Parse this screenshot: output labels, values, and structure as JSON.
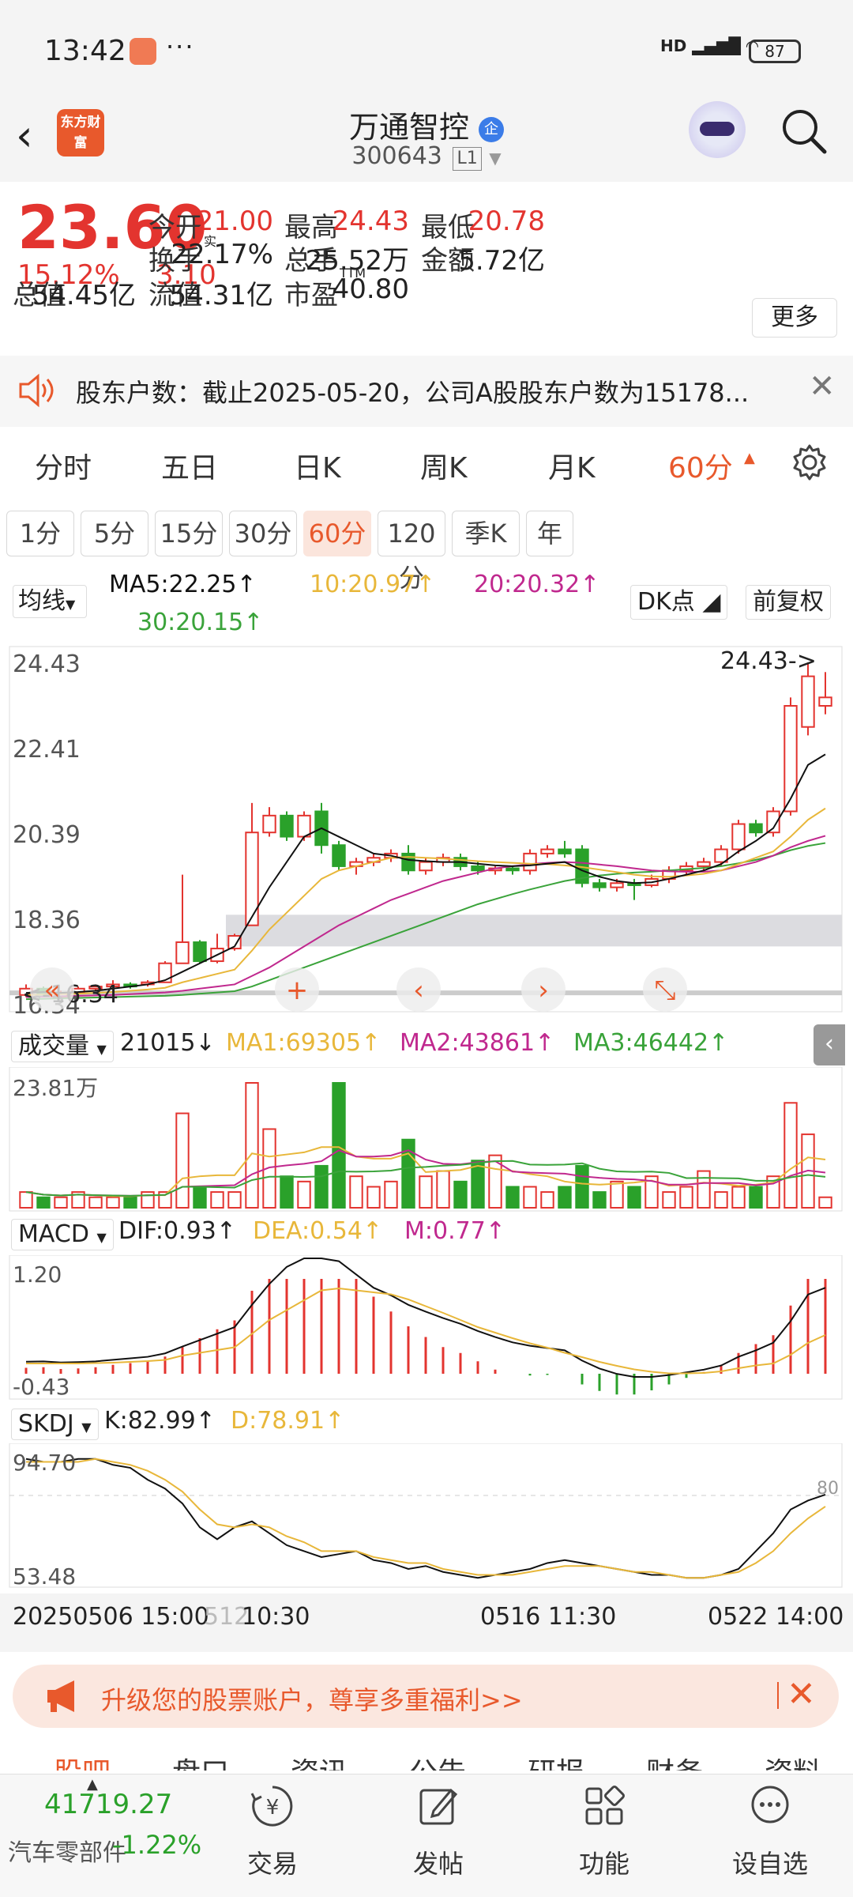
{
  "status_bar": {
    "time": "13:42",
    "battery": "87",
    "signal_label": "HD"
  },
  "header": {
    "logo_text": "东方财富",
    "stock_name": "万通智控",
    "stock_badge": "企",
    "stock_code": "300643",
    "market_tag": "L1"
  },
  "quote": {
    "price": "23.60",
    "change_pct": "15.12%",
    "change_amt": "3.10",
    "fields": [
      {
        "label": "今开",
        "value": "21.00",
        "color": "red"
      },
      {
        "label": "最高",
        "value": "24.43",
        "color": "red"
      },
      {
        "label": "最低",
        "value": "20.78",
        "color": "red"
      },
      {
        "label": "换手",
        "label_sup": "实",
        "value": "22.17%",
        "color": "black"
      },
      {
        "label": "总手",
        "value": "25.52万",
        "color": "black"
      },
      {
        "label": "金额",
        "value": "5.72亿",
        "color": "black"
      },
      {
        "label": "总值",
        "value": "54.45亿",
        "color": "black"
      },
      {
        "label": "流值",
        "value": "54.31亿",
        "color": "black"
      },
      {
        "label": "市盈",
        "label_sup": "TTM",
        "value": "40.80",
        "color": "black"
      }
    ],
    "more_label": "更多"
  },
  "notice": {
    "text": "股东户数：截止2025-05-20，公司A股股东户数为15178..."
  },
  "period_tabs": [
    "分时",
    "五日",
    "日K",
    "周K",
    "月K",
    "60分"
  ],
  "active_period": "60分",
  "sub_tabs": [
    "1分",
    "5分",
    "15分",
    "30分",
    "60分",
    "120分",
    "季K",
    "年"
  ],
  "active_sub_tab": "60分",
  "ma_legend": {
    "selector": "均线",
    "ma5": "MA5:22.25↑",
    "ma10": "10:20.97↑",
    "ma20": "20:20.32↑",
    "ma30": "30:20.15↑",
    "dk_label": "DK点",
    "adjust_label": "前复权"
  },
  "kline": {
    "y_labels": [
      "24.43",
      "22.41",
      "20.39",
      "18.36",
      "16.34"
    ],
    "high_marker": "24.43->",
    "low_marker": "<-16.34"
  },
  "volume": {
    "selector": "成交量",
    "current": "21015↓",
    "ma1": "MA1:69305↑",
    "ma2": "MA2:43861↑",
    "ma3": "MA3:46442↑",
    "y_label": "23.81万"
  },
  "macd": {
    "selector": "MACD",
    "dif": "DIF:0.93↑",
    "dea": "DEA:0.54↑",
    "m": "M:0.77↑",
    "y_labels": [
      "1.20",
      "-0.43"
    ]
  },
  "skdj": {
    "selector": "SKDJ",
    "k": "K:82.99↑",
    "d": "D:78.91↑",
    "y_labels": [
      "94.70",
      "53.48"
    ],
    "ref_label": "80"
  },
  "time_axis": [
    "20250506 15:00",
    "512 10:30",
    "0516 11:30",
    "0522 14:00"
  ],
  "ad": {
    "text": "升级您的股票账户，尊享多重福利>>"
  },
  "bottom_tabs": [
    "股吧",
    "盘口",
    "资讯",
    "公告",
    "研报",
    "财务",
    "资料"
  ],
  "bottom_bar": {
    "index_value": "41719.27",
    "index_name": "汽车零部件",
    "index_pct": "-1.22%",
    "buttons": [
      {
        "label": "交易",
        "icon": "yen-cycle-icon"
      },
      {
        "label": "发帖",
        "icon": "edit-icon"
      },
      {
        "label": "功能",
        "icon": "grid-icon"
      },
      {
        "label": "设自选",
        "icon": "chat-dots-icon"
      }
    ]
  },
  "colors": {
    "up": "#e3342f",
    "down": "#2aa12a",
    "ma5": "#111111",
    "ma10": "#e8b73a",
    "ma20": "#c0288e",
    "ma30": "#3aa33a",
    "accent": "#e8592c"
  },
  "chart_data": {
    "type": "candlestick",
    "y_range": [
      16.34,
      24.43
    ],
    "candles": [
      {
        "o": 16.55,
        "c": 16.7,
        "h": 16.8,
        "l": 16.5
      },
      {
        "o": 16.7,
        "c": 16.55,
        "h": 16.75,
        "l": 16.5
      },
      {
        "o": 16.5,
        "c": 16.6,
        "h": 16.65,
        "l": 16.45
      },
      {
        "o": 16.6,
        "c": 16.7,
        "h": 16.75,
        "l": 16.55
      },
      {
        "o": 16.7,
        "c": 16.75,
        "h": 16.8,
        "l": 16.65
      },
      {
        "o": 16.75,
        "c": 16.8,
        "h": 16.9,
        "l": 16.7
      },
      {
        "o": 16.8,
        "c": 16.75,
        "h": 16.85,
        "l": 16.7
      },
      {
        "o": 16.8,
        "c": 16.85,
        "h": 16.9,
        "l": 16.75
      },
      {
        "o": 16.85,
        "c": 17.3,
        "h": 17.35,
        "l": 16.85
      },
      {
        "o": 17.3,
        "c": 17.8,
        "h": 19.4,
        "l": 17.3
      },
      {
        "o": 17.8,
        "c": 17.35,
        "h": 17.85,
        "l": 17.3
      },
      {
        "o": 17.35,
        "c": 17.65,
        "h": 18.0,
        "l": 17.3
      },
      {
        "o": 17.65,
        "c": 17.95,
        "h": 18.0,
        "l": 17.6
      },
      {
        "o": 18.2,
        "c": 20.4,
        "h": 21.1,
        "l": 18.2
      },
      {
        "o": 20.4,
        "c": 20.8,
        "h": 21.0,
        "l": 20.3
      },
      {
        "o": 20.8,
        "c": 20.3,
        "h": 20.9,
        "l": 20.2
      },
      {
        "o": 20.3,
        "c": 20.8,
        "h": 20.9,
        "l": 20.2
      },
      {
        "o": 20.9,
        "c": 20.1,
        "h": 21.1,
        "l": 19.9
      },
      {
        "o": 20.1,
        "c": 19.6,
        "h": 20.2,
        "l": 19.5
      },
      {
        "o": 19.6,
        "c": 19.7,
        "h": 19.8,
        "l": 19.4
      },
      {
        "o": 19.7,
        "c": 19.8,
        "h": 19.9,
        "l": 19.6
      },
      {
        "o": 19.8,
        "c": 19.9,
        "h": 20.0,
        "l": 19.7
      },
      {
        "o": 19.9,
        "c": 19.5,
        "h": 20.1,
        "l": 19.4
      },
      {
        "o": 19.5,
        "c": 19.7,
        "h": 19.8,
        "l": 19.4
      },
      {
        "o": 19.7,
        "c": 19.8,
        "h": 19.9,
        "l": 19.6
      },
      {
        "o": 19.8,
        "c": 19.6,
        "h": 19.9,
        "l": 19.5
      },
      {
        "o": 19.6,
        "c": 19.5,
        "h": 19.7,
        "l": 19.4
      },
      {
        "o": 19.5,
        "c": 19.55,
        "h": 19.6,
        "l": 19.4
      },
      {
        "o": 19.55,
        "c": 19.5,
        "h": 19.6,
        "l": 19.4
      },
      {
        "o": 19.5,
        "c": 19.9,
        "h": 20.0,
        "l": 19.4
      },
      {
        "o": 19.9,
        "c": 20.0,
        "h": 20.1,
        "l": 19.8
      },
      {
        "o": 20.0,
        "c": 19.9,
        "h": 20.2,
        "l": 19.8
      },
      {
        "o": 20.0,
        "c": 19.2,
        "h": 20.1,
        "l": 19.1
      },
      {
        "o": 19.2,
        "c": 19.1,
        "h": 19.3,
        "l": 19.0
      },
      {
        "o": 19.1,
        "c": 19.2,
        "h": 19.3,
        "l": 19.0
      },
      {
        "o": 19.2,
        "c": 19.15,
        "h": 19.3,
        "l": 18.8
      },
      {
        "o": 19.15,
        "c": 19.3,
        "h": 19.4,
        "l": 19.1
      },
      {
        "o": 19.3,
        "c": 19.5,
        "h": 19.6,
        "l": 19.2
      },
      {
        "o": 19.5,
        "c": 19.6,
        "h": 19.7,
        "l": 19.4
      },
      {
        "o": 19.6,
        "c": 19.7,
        "h": 19.8,
        "l": 19.5
      },
      {
        "o": 19.7,
        "c": 20.0,
        "h": 20.1,
        "l": 19.6
      },
      {
        "o": 20.0,
        "c": 20.6,
        "h": 20.7,
        "l": 19.9
      },
      {
        "o": 20.6,
        "c": 20.4,
        "h": 20.7,
        "l": 20.3
      },
      {
        "o": 20.4,
        "c": 20.9,
        "h": 21.0,
        "l": 20.3
      },
      {
        "o": 20.9,
        "c": 23.4,
        "h": 23.6,
        "l": 20.8
      },
      {
        "o": 22.9,
        "c": 24.1,
        "h": 24.43,
        "l": 22.7
      },
      {
        "o": 23.4,
        "c": 23.6,
        "h": 24.2,
        "l": 23.2
      }
    ],
    "ma5": [
      16.6,
      16.62,
      16.6,
      16.62,
      16.65,
      16.7,
      16.75,
      16.8,
      16.9,
      17.1,
      17.3,
      17.5,
      17.7,
      18.4,
      19.1,
      19.7,
      20.3,
      20.5,
      20.3,
      20.1,
      19.9,
      19.85,
      19.75,
      19.72,
      19.7,
      19.7,
      19.66,
      19.62,
      19.6,
      19.62,
      19.66,
      19.7,
      19.5,
      19.35,
      19.25,
      19.2,
      19.22,
      19.3,
      19.4,
      19.5,
      19.65,
      19.95,
      20.2,
      20.5,
      21.2,
      22.0,
      22.25
    ],
    "ma10": [
      16.55,
      16.56,
      16.57,
      16.58,
      16.6,
      16.62,
      16.65,
      16.68,
      16.72,
      16.85,
      16.95,
      17.05,
      17.15,
      17.6,
      18.1,
      18.5,
      18.9,
      19.3,
      19.5,
      19.6,
      19.7,
      19.8,
      19.82,
      19.8,
      19.78,
      19.75,
      19.72,
      19.7,
      19.68,
      19.66,
      19.65,
      19.62,
      19.58,
      19.52,
      19.46,
      19.4,
      19.36,
      19.35,
      19.38,
      19.42,
      19.5,
      19.65,
      19.8,
      19.95,
      20.3,
      20.7,
      20.97
    ],
    "ma20": [
      16.5,
      16.51,
      16.52,
      16.53,
      16.54,
      16.55,
      16.57,
      16.59,
      16.61,
      16.65,
      16.7,
      16.75,
      16.8,
      17.0,
      17.2,
      17.45,
      17.7,
      17.95,
      18.2,
      18.4,
      18.6,
      18.8,
      18.95,
      19.1,
      19.25,
      19.35,
      19.45,
      19.55,
      19.6,
      19.65,
      19.68,
      19.7,
      19.68,
      19.64,
      19.6,
      19.55,
      19.5,
      19.48,
      19.47,
      19.47,
      19.5,
      19.6,
      19.7,
      19.85,
      20.05,
      20.2,
      20.32
    ],
    "ma30": [
      16.45,
      16.46,
      16.47,
      16.48,
      16.49,
      16.5,
      16.51,
      16.52,
      16.53,
      16.55,
      16.58,
      16.61,
      16.64,
      16.75,
      16.9,
      17.05,
      17.2,
      17.35,
      17.5,
      17.65,
      17.8,
      17.95,
      18.1,
      18.25,
      18.4,
      18.55,
      18.7,
      18.82,
      18.94,
      19.05,
      19.15,
      19.25,
      19.32,
      19.38,
      19.42,
      19.45,
      19.47,
      19.5,
      19.53,
      19.56,
      19.6,
      19.67,
      19.75,
      19.85,
      19.98,
      20.08,
      20.15
    ],
    "volume": [
      3,
      2,
      2,
      3,
      2,
      2,
      2,
      3,
      3,
      18,
      4,
      3,
      3,
      23.81,
      15,
      6,
      5,
      8,
      23.81,
      6,
      4,
      5,
      13,
      6,
      7,
      5,
      9,
      10,
      4,
      4,
      3,
      4,
      8,
      3,
      5,
      4,
      6,
      3,
      4,
      7,
      3,
      4,
      4,
      6,
      20,
      14,
      2
    ]
  }
}
